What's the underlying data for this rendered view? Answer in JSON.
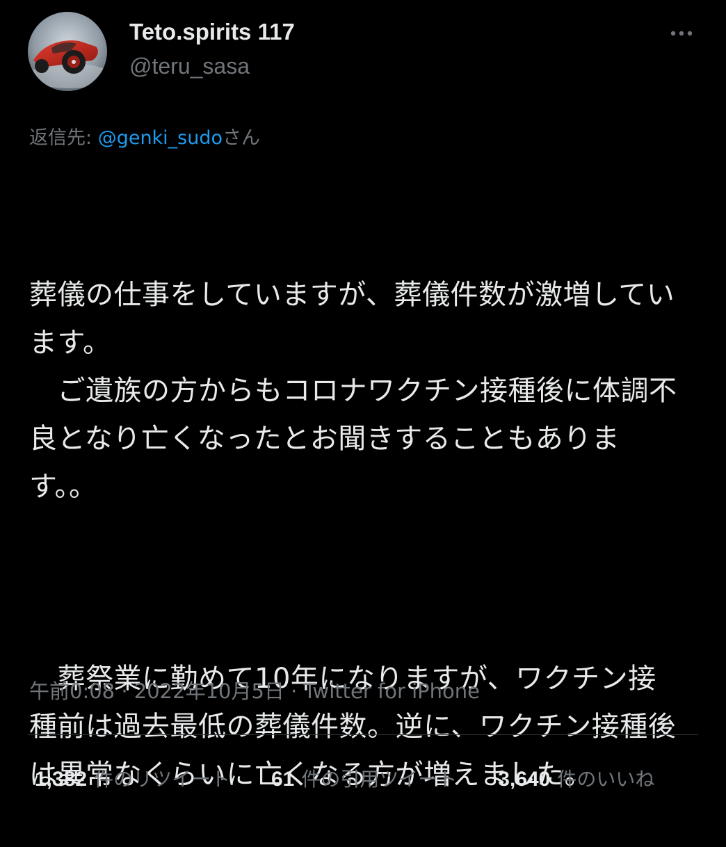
{
  "user": {
    "display_name": "Teto.spirits 117",
    "handle": "@teru_sasa",
    "avatar_icon": "race-car-avatar-icon"
  },
  "reply": {
    "prefix": "返信先: ",
    "mention": "@genki_sudo",
    "suffix": "さん"
  },
  "tweet": {
    "paragraph_1": "葬儀の仕事をしていますが、葬儀件数が激増しています。\n　ご遺族の方からもコロナワクチン接種後に体調不良となり亡くなったとお聞きすることもあります。。",
    "paragraph_2": "　葬祭業に勤めて10年になりますが、ワクチン接種前は過去最低の葬儀件数。逆に、ワクチン接種後は異常なくらいに亡くなる方が増えました。"
  },
  "meta": {
    "time": "午前0:08",
    "separator": " · ",
    "date": "2022年10月5日",
    "client": "Twitter for iPhone"
  },
  "stats": {
    "retweets_count": "1,382",
    "retweets_label": "件のリツイート",
    "quotes_count": "61",
    "quotes_label": "件の引用ツイート",
    "likes_count": "3,640",
    "likes_label": "件のいいね"
  },
  "colors": {
    "background": "#000000",
    "text": "#e7e9ea",
    "secondary": "#71767b",
    "accent": "#1d9bf0",
    "divider": "#2f3336"
  },
  "icons": {
    "more": "more-dots-icon"
  }
}
